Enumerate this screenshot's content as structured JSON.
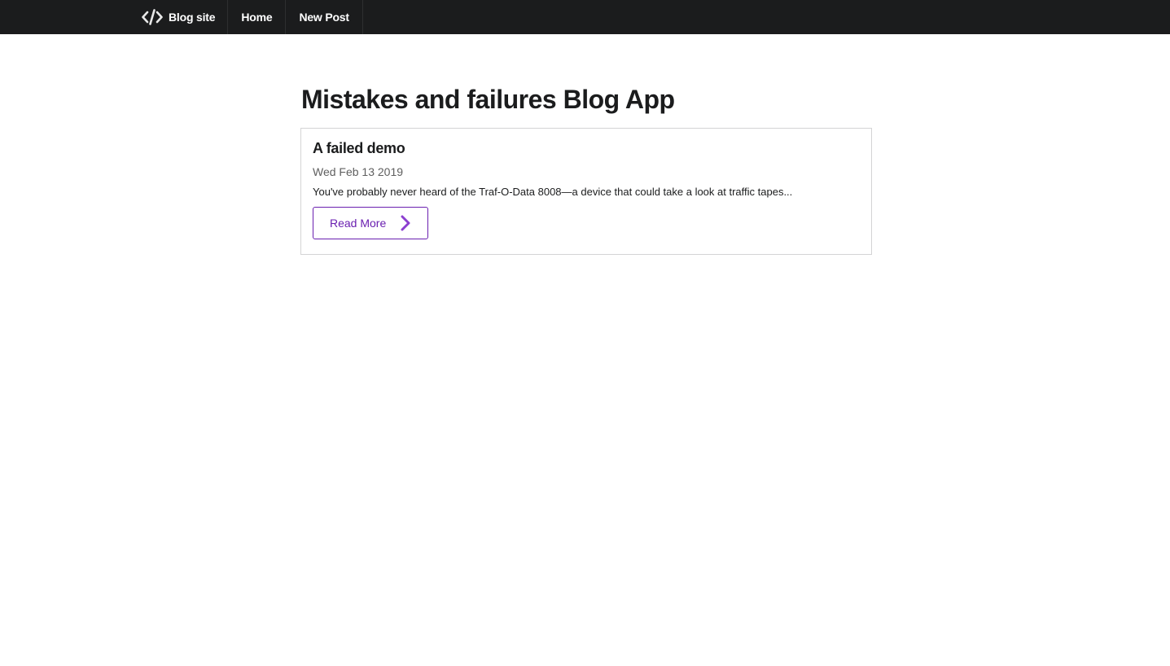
{
  "navbar": {
    "brand": {
      "icon": "code-icon",
      "label": "Blog site"
    },
    "items": [
      {
        "label": "Home"
      },
      {
        "label": "New Post"
      }
    ],
    "background": "#1b1c1d"
  },
  "page": {
    "title": "Mistakes and failures Blog App"
  },
  "posts": [
    {
      "title": "A failed demo",
      "date": "Wed Feb 13 2019",
      "excerpt": "You've probably never heard of the Traf-O-Data 8008—a device that could take a look at traffic tapes...",
      "button_label": "Read More",
      "button_icon": "chevron-right-icon"
    }
  ],
  "colors": {
    "accent": "#6a1fb0",
    "text": "#1b1c1d",
    "muted": "#5f5f5f",
    "border": "#d4d4d5"
  }
}
